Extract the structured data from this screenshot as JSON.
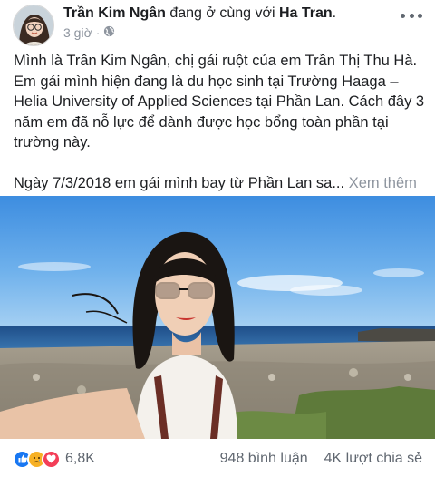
{
  "post": {
    "author": "Trần Kim Ngân",
    "with_text": "đang ở cùng với",
    "tagged": "Ha Tran",
    "tagged_suffix": ".",
    "time": "3 giờ",
    "sep": "·",
    "privacy_icon": "globe-icon",
    "paragraph1": "Mình là Trần Kim Ngân, chị gái ruột của em Trần Thị Thu Hà. Em gái mình hiện đang là du học sinh tại Trường Haaga – Helia University of Applied Sciences tại Phần Lan. Cách đây 3 năm em đã nỗ lực để dành được học bổng toàn phần tại trường này.",
    "paragraph2": "Ngày 7/3/2018 em gái mình bay từ Phần Lan sa...",
    "see_more": "Xem thêm"
  },
  "footer": {
    "reaction_icons": [
      "like-icon",
      "sad-icon",
      "love-icon"
    ],
    "reaction_count": "6,8K",
    "comments": "948 bình luận",
    "shares": "4K lượt chia sẻ"
  },
  "colors": {
    "like": "#1877f2",
    "sad": "#f7b125",
    "love": "#f33e58",
    "secondary_text": "#8d949e"
  }
}
